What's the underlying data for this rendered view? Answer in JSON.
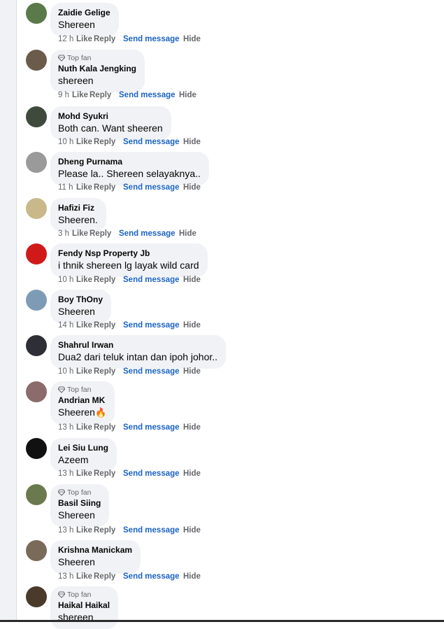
{
  "comments": [
    {
      "author": "Zaidie Gelige",
      "text": "Shereen",
      "time": "12 h",
      "top_fan": false,
      "avatar_color": "#5a7a4a"
    },
    {
      "author": "Nuth Kala Jengking",
      "text": "shereen",
      "time": "9 h",
      "top_fan": true,
      "avatar_color": "#6b5b4a"
    },
    {
      "author": "Mohd Syukri",
      "text": "Both can. Want sheeren",
      "time": "10 h",
      "top_fan": false,
      "avatar_color": "#3f4a3c"
    },
    {
      "author": "Dheng Purnama",
      "text": "Please la.. Shereen selayaknya..",
      "time": "11 h",
      "top_fan": false,
      "avatar_color": "#9a9a9a"
    },
    {
      "author": "Hafizi Fiz",
      "text": "Sheeren.",
      "time": "3 h",
      "top_fan": false,
      "avatar_color": "#c9b98a"
    },
    {
      "author": "Fendy Nsp Property Jb",
      "text": "i thnik shereen lg layak wild card",
      "time": "10 h",
      "top_fan": false,
      "avatar_color": "#d01a1a"
    },
    {
      "author": "Boy ThOny",
      "text": "Sheeren",
      "time": "14 h",
      "top_fan": false,
      "avatar_color": "#7d9bb5"
    },
    {
      "author": "Shahrul Irwan",
      "text": "Dua2 dari teluk intan dan ipoh johor..",
      "time": "10 h",
      "top_fan": false,
      "avatar_color": "#2e2e36"
    },
    {
      "author": "Andrian MK",
      "text": "Sheeren",
      "emoji": "🔥",
      "time": "13 h",
      "top_fan": true,
      "avatar_color": "#8b6b6b"
    },
    {
      "author": "Lei Siu Lung",
      "text": "Azeem",
      "time": "13 h",
      "top_fan": false,
      "avatar_color": "#111111"
    },
    {
      "author": "Basil Siing",
      "text": "Shereen",
      "time": "13 h",
      "top_fan": true,
      "avatar_color": "#6b7a4e"
    },
    {
      "author": "Krishna Manickam",
      "text": "Sheeren",
      "time": "13 h",
      "top_fan": false,
      "avatar_color": "#7a6a5a"
    },
    {
      "author": "Haikal Haikal",
      "text": "shereen",
      "time": "",
      "top_fan": true,
      "avatar_color": "#4a3a2a"
    }
  ],
  "labels": {
    "top_fan": "Top fan",
    "like": "Like",
    "reply": "Reply",
    "send_message": "Send message",
    "hide": "Hide"
  }
}
